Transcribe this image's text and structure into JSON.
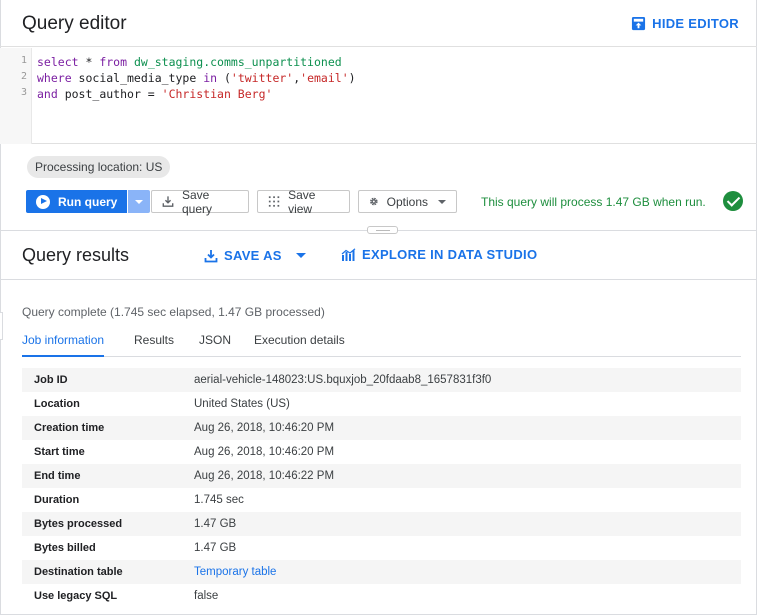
{
  "editor": {
    "title": "Query editor",
    "hide_editor": "HIDE EDITOR",
    "line_numbers": [
      "1",
      "2",
      "3"
    ],
    "code": {
      "l1_kw1": "select",
      "l1_p1": " * ",
      "l1_kw2": "from",
      "l1_p2": " ",
      "l1_tbl": "dw_staging.comms_unpartitioned",
      "l2_kw1": "where",
      "l2_p1": " social_media_type ",
      "l2_kw2": "in",
      "l2_p2": " (",
      "l2_s1": "'twitter'",
      "l2_p3": ",",
      "l2_s2": "'email'",
      "l2_p4": ")",
      "l3_kw1": "and",
      "l3_p1": " post_author = ",
      "l3_s1": "'Christian Berg'"
    }
  },
  "toolbar": {
    "processing_location": "Processing location: US",
    "run_query": "Run query",
    "save_query": "Save query",
    "save_view": "Save view",
    "options": "Options",
    "process_message": "This query will process 1.47 GB when run."
  },
  "results": {
    "title": "Query results",
    "save_as": "SAVE AS",
    "explore": "EXPLORE IN DATA STUDIO",
    "complete_message": "Query complete (1.745 sec elapsed, 1.47 GB processed)",
    "tabs": [
      "Job information",
      "Results",
      "JSON",
      "Execution details"
    ],
    "active_tab": "Job information"
  },
  "job_info": [
    {
      "key": "Job ID",
      "value": "aerial-vehicle-148023:US.bquxjob_20fdaab8_1657831f3f0"
    },
    {
      "key": "Location",
      "value": "United States (US)"
    },
    {
      "key": "Creation time",
      "value": "Aug 26, 2018, 10:46:20 PM"
    },
    {
      "key": "Start time",
      "value": "Aug 26, 2018, 10:46:20 PM"
    },
    {
      "key": "End time",
      "value": "Aug 26, 2018, 10:46:22 PM"
    },
    {
      "key": "Duration",
      "value": "1.745 sec"
    },
    {
      "key": "Bytes processed",
      "value": "1.47 GB"
    },
    {
      "key": "Bytes billed",
      "value": "1.47 GB"
    },
    {
      "key": "Destination table",
      "value": "Temporary table"
    },
    {
      "key": "Use legacy SQL",
      "value": "false"
    }
  ],
  "colors": {
    "accent": "#1a73e8",
    "success": "#1e8e3e",
    "keyword": "#7b1fa2",
    "string": "#c62828",
    "table": "#0d904f"
  },
  "icons": [
    "hide-editor-icon",
    "play-icon",
    "download-icon",
    "grid-icon",
    "gear-icon",
    "check-circle-icon",
    "save-as-download-icon",
    "bar-chart-icon"
  ]
}
